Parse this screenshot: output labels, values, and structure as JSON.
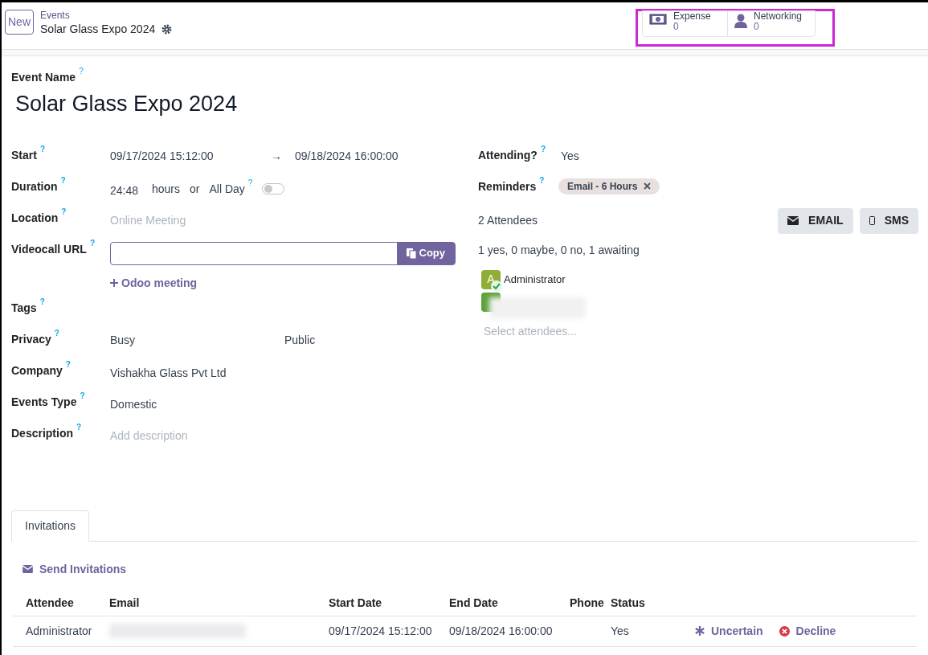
{
  "control_panel": {
    "new_button": "New",
    "breadcrumb": "Events",
    "record_title": "Solar Glass Expo 2024"
  },
  "stat_buttons": [
    {
      "kind": "money",
      "label": "Expense",
      "count": "0"
    },
    {
      "kind": "person",
      "label": "Networking",
      "count": "0"
    }
  ],
  "highlight": true,
  "event_name": {
    "label": "Event Name",
    "help": "?",
    "value": "Solar Glass Expo 2024"
  },
  "left_fields": [
    {
      "kind": "range",
      "label": "Start",
      "help": "?",
      "from": "09/17/2024 15:12:00",
      "arrow": "→",
      "to": "09/18/2024 16:00:00"
    },
    {
      "kind": "duration",
      "label": "Duration",
      "help": "?",
      "value": "24:48",
      "unit": "hours",
      "or": "or",
      "allday_label": "All Day",
      "allday_help": "?",
      "all_day": false
    },
    {
      "kind": "placeholder",
      "label": "Location",
      "help": "?",
      "placeholder": "Online Meeting"
    },
    {
      "kind": "url",
      "label": "Videocall URL",
      "help": "?",
      "button": "Copy",
      "link": "Odoo meeting"
    },
    {
      "kind": "empty",
      "label": "Tags",
      "help": "?"
    },
    {
      "kind": "pair",
      "label": "Privacy",
      "help": "?",
      "value": "Busy",
      "value2": "Public"
    },
    {
      "kind": "text",
      "label": "Company",
      "help": "?",
      "value": "Vishakha Glass Pvt Ltd"
    },
    {
      "kind": "text",
      "label": "Events Type",
      "help": "?",
      "value": "Domestic"
    },
    {
      "kind": "placeholder",
      "label": "Description",
      "help": "?",
      "placeholder": "Add description"
    }
  ],
  "attending": {
    "label": "Attending?",
    "help": "?",
    "value": "Yes"
  },
  "reminders": {
    "label": "Reminders",
    "help": "?",
    "tags": [
      "Email - 6 Hours"
    ]
  },
  "attendees": {
    "count": "2 Attendees",
    "buttons": [
      {
        "kind": "email",
        "label": "EMAIL"
      },
      {
        "kind": "sms",
        "label": "SMS"
      }
    ],
    "summary": "1 yes, 0 maybe, 0 no, 1 awaiting",
    "people": [
      {
        "initial": "A",
        "name": "Administrator",
        "accepted": true,
        "blurred": false,
        "color": "#8fae35"
      },
      {
        "accepted": false,
        "blurred": true,
        "color": "#5ea23a"
      }
    ],
    "placeholder": "Select attendees..."
  },
  "tabs": [
    {
      "label": "Invitations",
      "selected": true
    }
  ],
  "send_invitations": "Send Invitations",
  "table": {
    "columns": [
      "Attendee",
      "Email",
      "Start Date",
      "End Date",
      "Phone",
      "Status"
    ],
    "rows": [
      {
        "attendee": "Administrator",
        "email_blurred": true,
        "start": "09/17/2024 15:12:00",
        "end": "09/18/2024 16:00:00",
        "status": "Yes",
        "actions": [
          {
            "kind": "uncertain",
            "label": "Uncertain"
          },
          {
            "kind": "decline",
            "label": "Decline"
          }
        ]
      }
    ]
  }
}
